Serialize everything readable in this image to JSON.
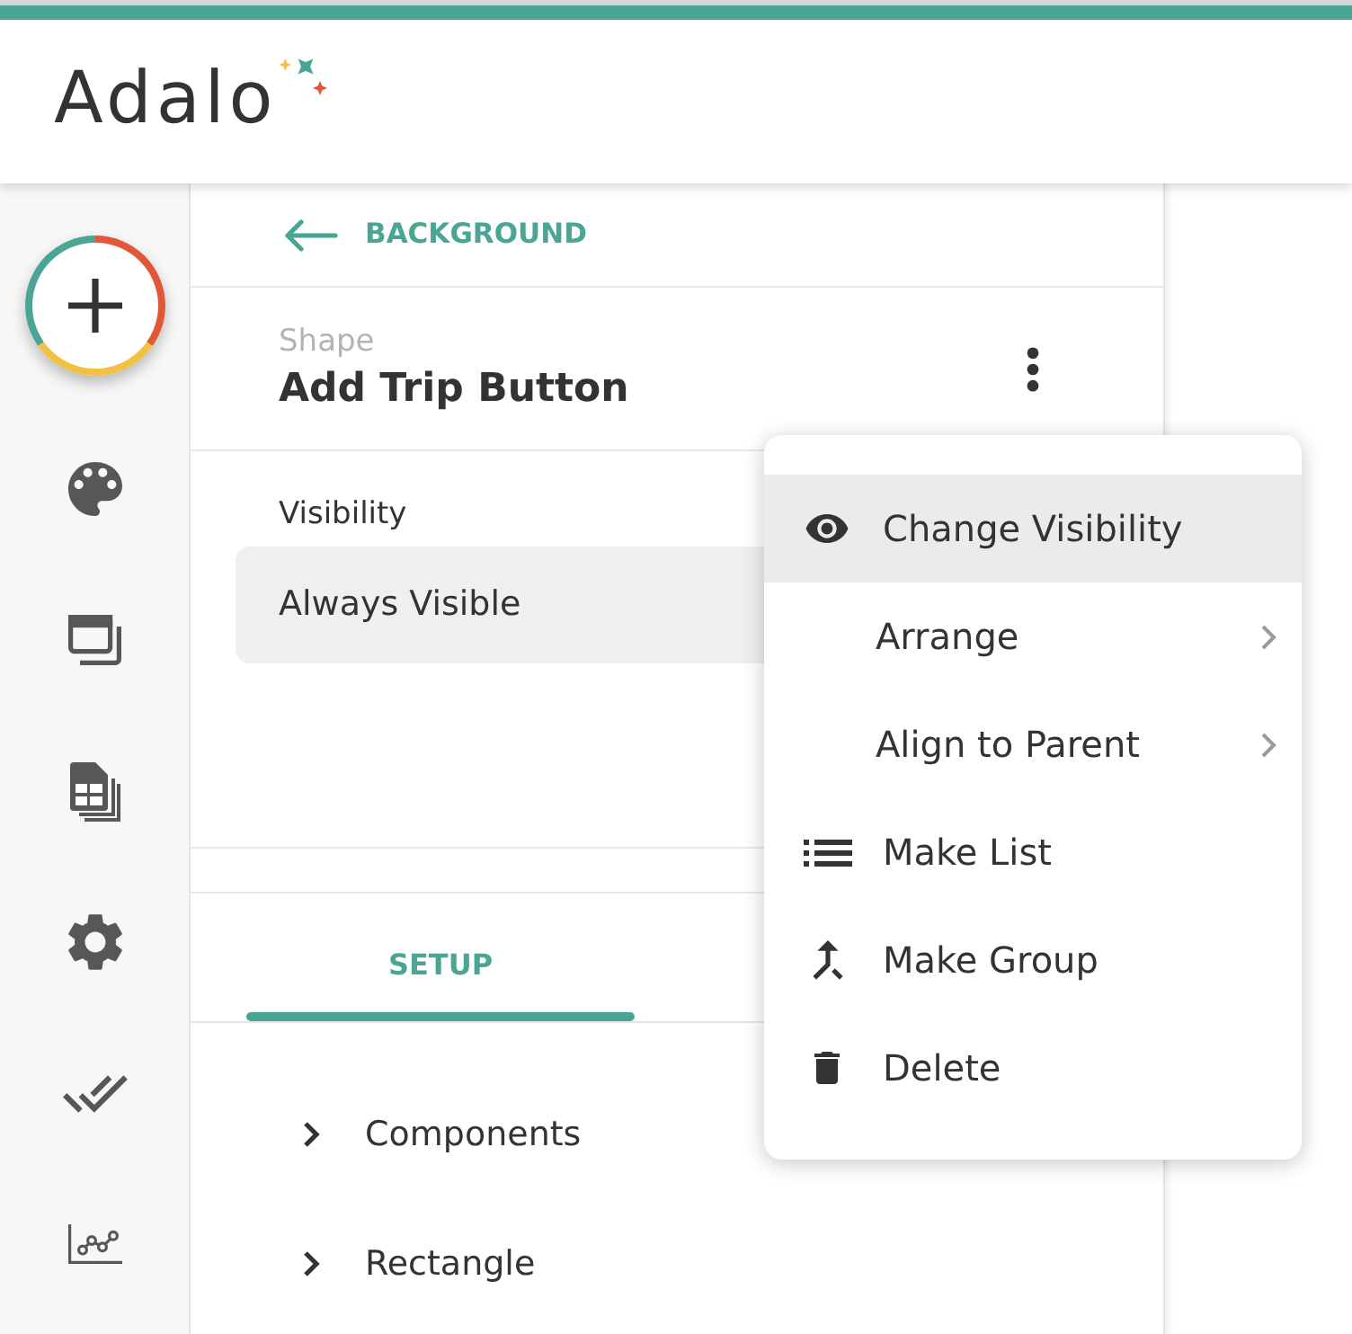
{
  "header": {
    "logo": "Adalo"
  },
  "panel": {
    "back_link": "BACKGROUND",
    "element_type": "Shape",
    "element_name": "Add Trip Button",
    "visibility": {
      "label": "Visibility",
      "value": "Always Visible"
    },
    "tabs": [
      {
        "label": "SETUP",
        "selected": true
      }
    ],
    "tree": [
      {
        "label": "Components",
        "expanded": false
      },
      {
        "label": "Rectangle",
        "expanded": false
      }
    ]
  },
  "context_menu": {
    "items": [
      {
        "label": "Change Visibility",
        "kind": "visibility",
        "highlighted": true
      },
      {
        "label": "Arrange",
        "kind": "submenu",
        "highlighted": false
      },
      {
        "label": "Align to Parent",
        "kind": "submenu",
        "highlighted": false
      },
      {
        "label": "Make List",
        "kind": "list",
        "highlighted": false
      },
      {
        "label": "Make Group",
        "kind": "group",
        "highlighted": false
      },
      {
        "label": "Delete",
        "kind": "delete",
        "highlighted": false
      }
    ]
  }
}
